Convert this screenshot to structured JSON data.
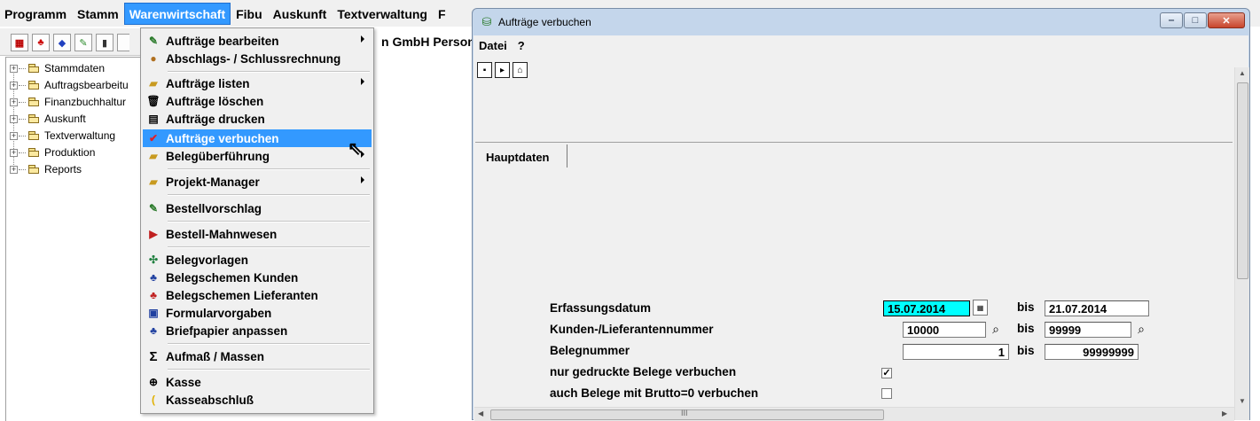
{
  "menubar": {
    "items": [
      "Programm",
      "Stamm",
      "Warenwirtschaft",
      "Fibu",
      "Auskunft",
      "Textverwaltung",
      "F"
    ],
    "active": "Warenwirtschaft"
  },
  "company": {
    "text": "n GmbH  Person"
  },
  "tree": {
    "items": [
      "Stammdaten",
      "Auftragsbearbeitu",
      "Finanzbuchhaltur",
      "Auskunft",
      "Textverwaltung",
      "Produktion",
      "Reports"
    ]
  },
  "dropdown": {
    "items": [
      {
        "label": "Aufträge bearbeiten",
        "icon": "edit-orders-icon"
      },
      {
        "label": "Abschlags- / Schlussrechnung",
        "icon": "invoice-icon"
      },
      {
        "label": "Aufträge listen",
        "icon": "folder-open-icon"
      },
      {
        "label": "Aufträge löschen",
        "icon": "trash-icon"
      },
      {
        "label": "Aufträge drucken",
        "icon": "printer-icon"
      },
      {
        "label": "Aufträge verbuchen",
        "icon": "checkmark-icon"
      },
      {
        "label": "Belegüberführung",
        "icon": "folder-open-icon"
      },
      {
        "label": "Projekt-Manager",
        "icon": "folder-open-icon"
      },
      {
        "label": "Bestellvorschlag",
        "icon": "order-proposal-icon"
      },
      {
        "label": "Bestell-Mahnwesen",
        "icon": "reminder-icon"
      },
      {
        "label": "Belegvorlagen",
        "icon": "template-icon"
      },
      {
        "label": "Belegschemen Kunden",
        "icon": "customer-schema-icon"
      },
      {
        "label": "Belegschemen Lieferanten",
        "icon": "supplier-schema-icon"
      },
      {
        "label": "Formularvorgaben",
        "icon": "form-icon"
      },
      {
        "label": "Briefpapier anpassen",
        "icon": "letterhead-icon"
      },
      {
        "label": "Aufmaß / Massen",
        "icon": "sigma-icon"
      },
      {
        "label": "Kasse",
        "icon": "cash-register-icon"
      },
      {
        "label": "Kasseabschluß",
        "icon": "cash-close-icon"
      }
    ],
    "selected": "Aufträge verbuchen"
  },
  "window": {
    "title": "Aufträge verbuchen",
    "menu": [
      "Datei",
      "?"
    ],
    "tab": "Hauptdaten",
    "fields": {
      "erfassungsdatum_label": "Erfassungsdatum",
      "erfassungsdatum_from": "15.07.2014",
      "erfassungsdatum_to": "21.07.2014",
      "kunden_label": "Kunden-/Lieferantennummer",
      "kunden_from": "10000",
      "kunden_to": "99999",
      "beleg_label": "Belegnummer",
      "beleg_from": "1",
      "beleg_to": "99999999",
      "bis": "bis",
      "gedruckte_label": "nur gedruckte Belege verbuchen",
      "gedruckte_checked": true,
      "brutto_label": "auch Belege mit Brutto=0 verbuchen",
      "brutto_checked": false
    },
    "scrollbar_mark": "III"
  },
  "colors": {
    "selection": "#3399ff",
    "highlight_field": "#00ffff",
    "titlebar": "#c4d6eb"
  }
}
